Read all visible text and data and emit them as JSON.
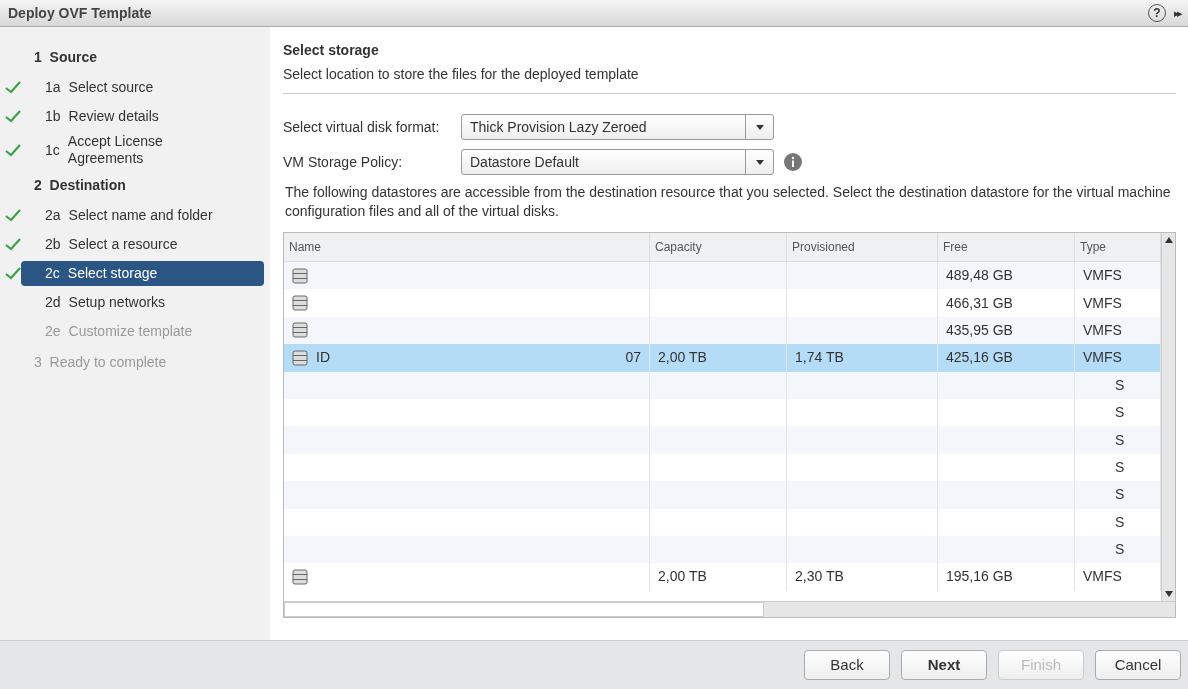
{
  "window": {
    "title": "Deploy OVF Template",
    "help": "?",
    "expand": "▸▸"
  },
  "steps": [
    {
      "label": "1  Source",
      "disabled": false,
      "children": [
        {
          "number": "1a",
          "label": "Select source",
          "done": true,
          "selected": false,
          "disabled": false
        },
        {
          "number": "1b",
          "label": "Review details",
          "done": true,
          "selected": false,
          "disabled": false
        },
        {
          "number": "1c",
          "label": "Accept License Agreements",
          "done": true,
          "selected": false,
          "disabled": false
        }
      ]
    },
    {
      "label": "2  Destination",
      "disabled": false,
      "children": [
        {
          "number": "2a",
          "label": "Select name and folder",
          "done": true,
          "selected": false,
          "disabled": false
        },
        {
          "number": "2b",
          "label": "Select a resource",
          "done": true,
          "selected": false,
          "disabled": false
        },
        {
          "number": "2c",
          "label": "Select storage",
          "done": true,
          "selected": true,
          "disabled": false
        },
        {
          "number": "2d",
          "label": "Setup networks",
          "done": false,
          "selected": false,
          "disabled": false
        },
        {
          "number": "2e",
          "label": "Customize template",
          "done": false,
          "selected": false,
          "disabled": true
        }
      ]
    },
    {
      "label": "3  Ready to complete",
      "disabled": true
    }
  ],
  "page": {
    "title": "Select storage",
    "subtitle": "Select location to store the files for the deployed template"
  },
  "fields": [
    {
      "label": "Select virtual disk format:",
      "value": "Thick Provision Lazy Zeroed",
      "info": false
    },
    {
      "label": "VM Storage Policy:",
      "value": "Datastore Default",
      "info": true
    }
  ],
  "description": "The following datastores are accessible from the destination resource that you selected. Select the destination datastore for the virtual machine configuration files and all of the virtual disks.",
  "table": {
    "columns": [
      "Name",
      "Capacity",
      "Provisioned",
      "Free",
      "Type"
    ],
    "rows": [
      {
        "icon": true,
        "free": "489,48 GB",
        "type": "VMFS",
        "selected": false
      },
      {
        "icon": true,
        "free": "466,31 GB",
        "type": "VMFS",
        "selected": false
      },
      {
        "icon": true,
        "free": "435,95 GB",
        "type": "VMFS",
        "selected": false
      },
      {
        "icon": true,
        "name": "ID",
        "name_end": "07",
        "capacity": "2,00 TB",
        "provisioned": "1,74 TB",
        "free": "425,16 GB",
        "type": "VMFS",
        "selected": true
      },
      {
        "icon": false,
        "type": "S",
        "selected": false
      },
      {
        "icon": false,
        "type": "S",
        "selected": false
      },
      {
        "icon": false,
        "type": "S",
        "selected": false
      },
      {
        "icon": false,
        "type": "S",
        "selected": false
      },
      {
        "icon": false,
        "type": "S",
        "selected": false
      },
      {
        "icon": false,
        "type": "S",
        "selected": false
      },
      {
        "icon": false,
        "type": "S",
        "selected": false
      },
      {
        "icon": true,
        "capacity": "2,00 TB",
        "provisioned": "2,30 TB",
        "free": "195,16 GB",
        "type": "VMFS",
        "selected": false
      }
    ]
  },
  "buttons": [
    {
      "label": "Back",
      "kind": "normal",
      "disabled": false
    },
    {
      "label": "Next",
      "kind": "primary",
      "disabled": false
    },
    {
      "label": "Finish",
      "kind": "normal",
      "disabled": true
    },
    {
      "label": "Cancel",
      "kind": "normal",
      "disabled": false
    }
  ]
}
